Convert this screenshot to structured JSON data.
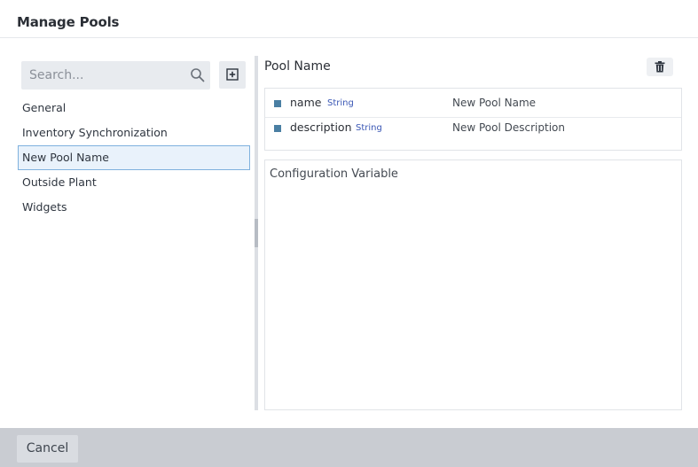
{
  "dialog": {
    "title": "Manage Pools"
  },
  "sidebar": {
    "search_placeholder": "Search...",
    "items": [
      {
        "label": "General"
      },
      {
        "label": "Inventory Synchronization"
      },
      {
        "label": "New Pool Name"
      },
      {
        "label": "Outside Plant"
      },
      {
        "label": "Widgets"
      }
    ],
    "selected_index": 2
  },
  "detail": {
    "title": "Pool Name",
    "properties": [
      {
        "name": "name",
        "type": "String",
        "value": "New Pool Name"
      },
      {
        "name": "description",
        "type": "String",
        "value": "New Pool Description"
      }
    ],
    "config_label": "Configuration Variable"
  },
  "footer": {
    "cancel_label": "Cancel"
  },
  "colors": {
    "accent_border": "#7fb1de",
    "selected_bg": "#e9f2fb",
    "type_text": "#3a57b5",
    "marker": "#4a7fa3",
    "footer_bg": "#c9ccd2"
  }
}
